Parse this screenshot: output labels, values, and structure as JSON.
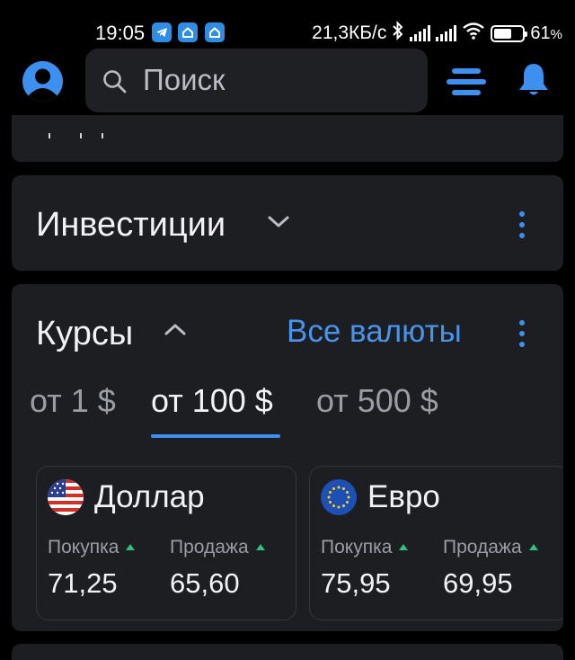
{
  "status_bar": {
    "time": "19:05",
    "speed": "21,3КБ/с",
    "battery_level": 0.61,
    "battery_percent": "61",
    "battery_percent_sign": "%",
    "icons": [
      "telegram-icon",
      "home-app-icon",
      "home-app-icon",
      "bluetooth-icon",
      "signal-icon",
      "signal-icon",
      "wifi-icon",
      "battery-icon"
    ]
  },
  "header": {
    "search_placeholder": "Поиск",
    "accent_color": "#3d8ff0"
  },
  "investments": {
    "title": "Инвестиции"
  },
  "rates": {
    "title": "Курсы",
    "all_currencies_link": "Все валюты",
    "tabs": [
      {
        "label": "от 1 $",
        "active": false
      },
      {
        "label": "от 100 $",
        "active": true
      },
      {
        "label": "от 500 $",
        "active": false
      }
    ],
    "currencies": [
      {
        "name": "Доллар",
        "flag": "us-flag-icon",
        "buy_label": "Покупка",
        "buy": "71,25",
        "sell_label": "Продажа",
        "sell": "65,60"
      },
      {
        "name": "Евро",
        "flag": "eu-flag-icon",
        "buy_label": "Покупка",
        "buy": "75,95",
        "sell_label": "Продажа",
        "sell": "69,95"
      }
    ],
    "trend_color": "#2ec27e"
  }
}
